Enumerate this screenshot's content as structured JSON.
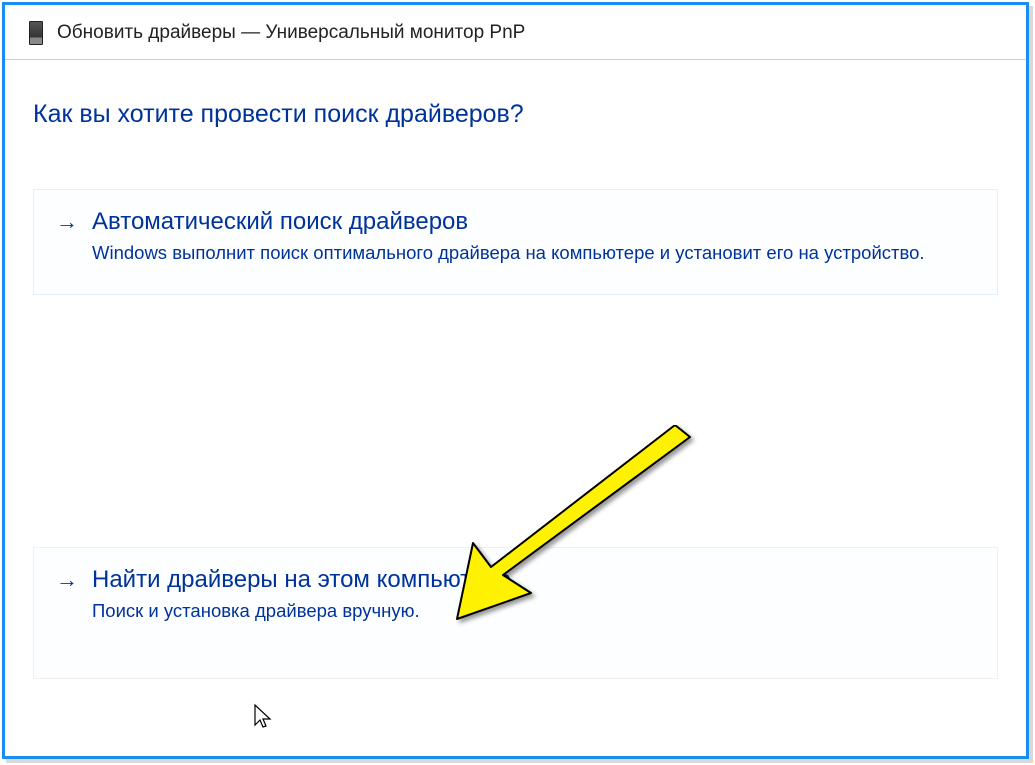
{
  "header": {
    "title": "Обновить драйверы — Универсальный монитор PnP",
    "icon": "device-tower-icon"
  },
  "content": {
    "question": "Как вы хотите провести поиск драйверов?"
  },
  "options": [
    {
      "arrow": "→",
      "title": "Автоматический поиск драйверов",
      "description": "Windows выполнит поиск оптимального драйвера на компьютере и установит его на устройство."
    },
    {
      "arrow": "→",
      "title": "Найти драйверы на этом компьютере",
      "description": "Поиск и установка драйвера вручную."
    }
  ],
  "annotation": {
    "type": "yellow-arrow-pointer"
  }
}
